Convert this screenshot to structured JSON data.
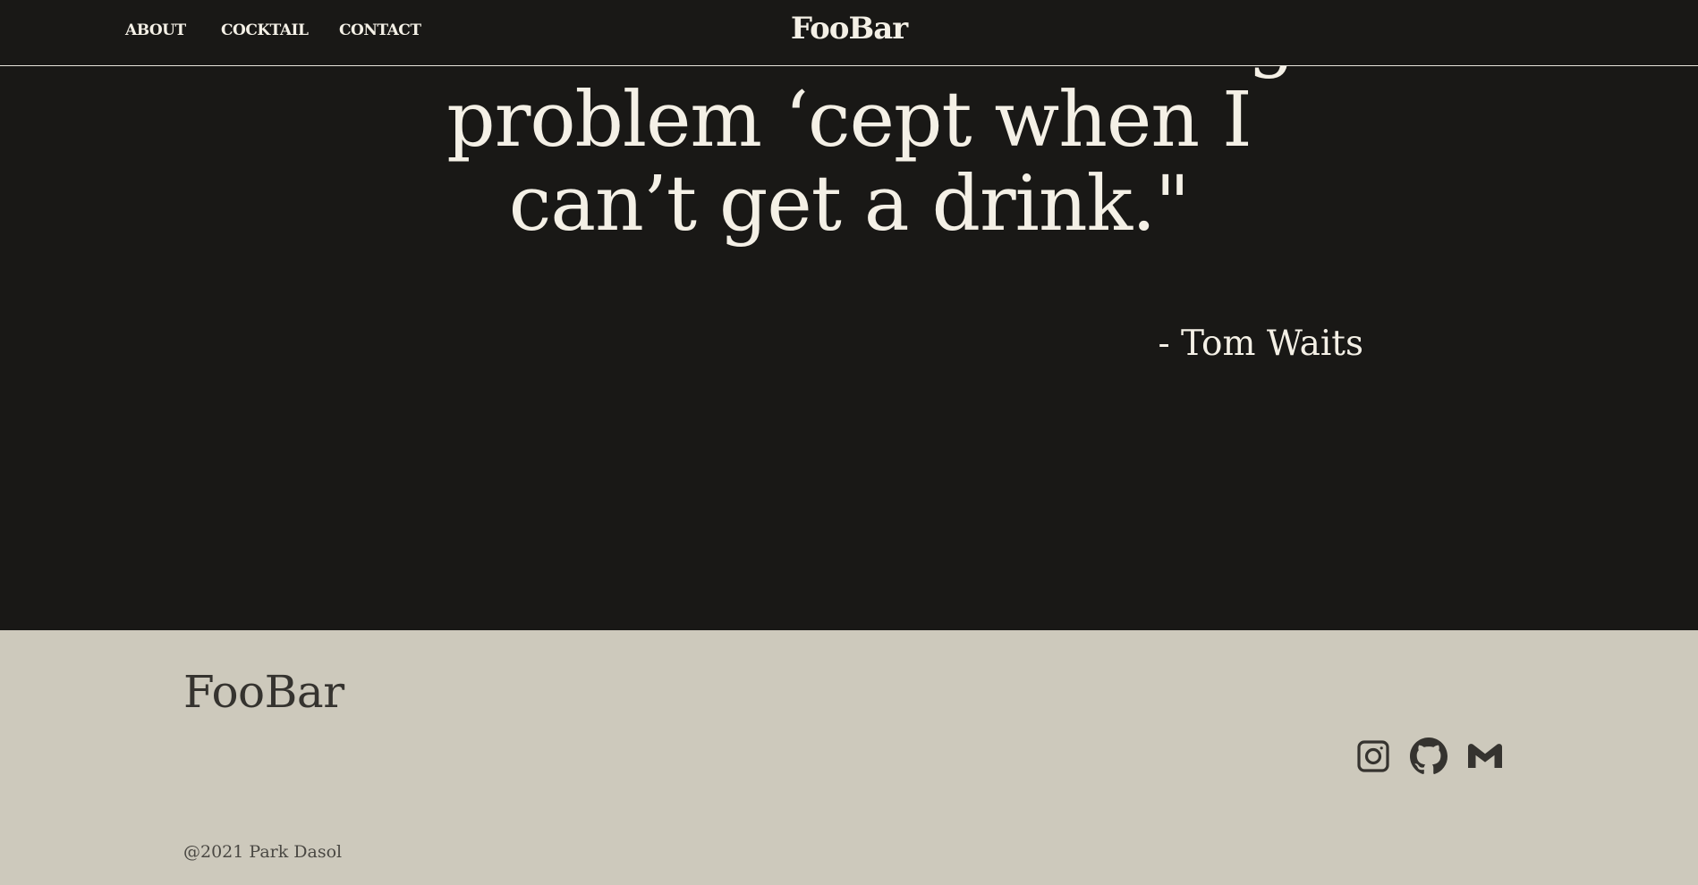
{
  "nav": {
    "links": [
      {
        "label": "ABOUT"
      },
      {
        "label": "COCKTAIL"
      },
      {
        "label": "CONTACT"
      }
    ],
    "brand": "FooBar"
  },
  "quote": {
    "text": "\"I don’t have a drinking problem ‘cept when I can’t get a drink.\"",
    "author": "- Tom Waits"
  },
  "footer": {
    "brand": "FooBar",
    "social": [
      {
        "icon": "instagram-icon"
      },
      {
        "icon": "github-icon"
      },
      {
        "icon": "gmail-icon"
      }
    ],
    "copyright": "@2021 Park Dasol"
  },
  "colors": {
    "dark_background": "#191816",
    "light_text": "#f4f0e6",
    "footer_background": "#cdc9bc",
    "footer_text": "#35332f"
  }
}
